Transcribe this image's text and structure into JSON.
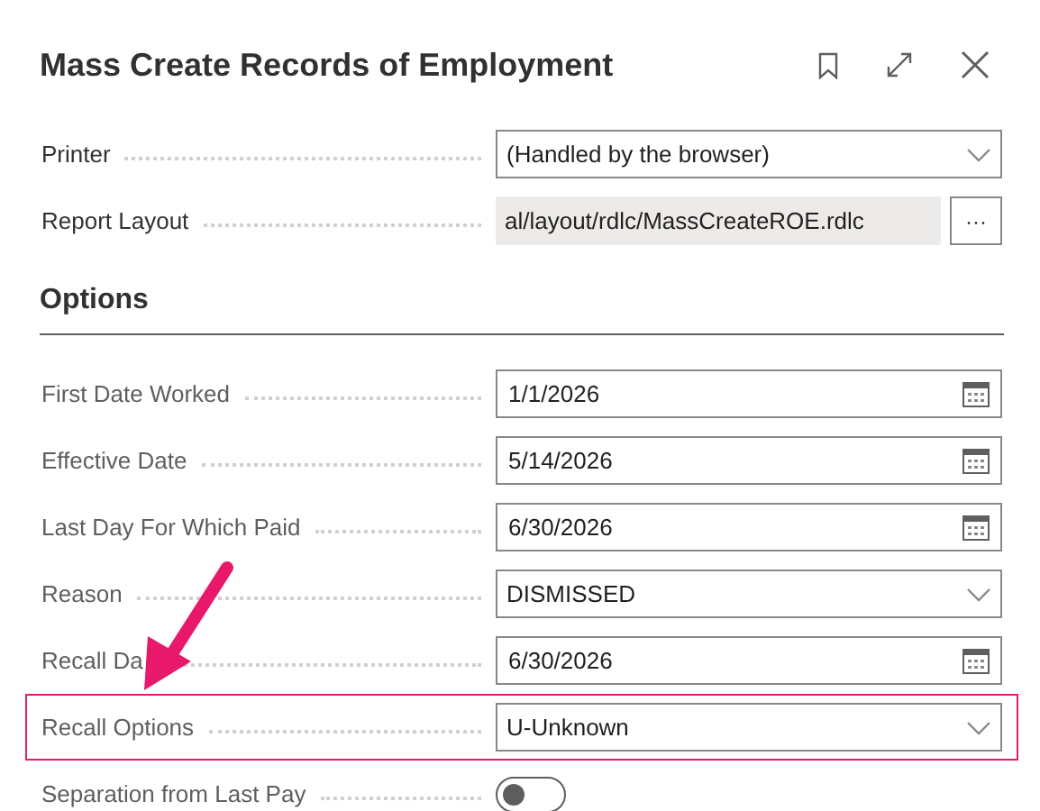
{
  "dialog": {
    "title": "Mass Create Records of Employment"
  },
  "fields": [
    {
      "label": "Printer",
      "kind": "dropdown",
      "value": "(Handled by the browser)"
    },
    {
      "label": "Report Layout",
      "kind": "readonly",
      "value": "al/layout/rdlc/MassCreateROE.rdlc",
      "button": "···"
    }
  ],
  "options": {
    "heading": "Options",
    "fields": [
      {
        "label": "First Date Worked",
        "kind": "date",
        "value": "1/1/2026",
        "highlighted": false
      },
      {
        "label": "Effective Date",
        "kind": "date",
        "value": "5/14/2026",
        "highlighted": false
      },
      {
        "label": "Last Day For Which Paid",
        "kind": "date",
        "value": "6/30/2026",
        "highlighted": false
      },
      {
        "label": "Reason",
        "kind": "dropdown",
        "value": "DISMISSED",
        "highlighted": false
      },
      {
        "label": "Recall Da",
        "kind": "date",
        "value": "6/30/2026",
        "highlighted": false
      },
      {
        "label": "Recall Options",
        "kind": "dropdown",
        "value": "U-Unknown",
        "highlighted": true
      },
      {
        "label": "Separation from Last Pay",
        "kind": "toggle",
        "on": false,
        "highlighted": false
      }
    ]
  }
}
